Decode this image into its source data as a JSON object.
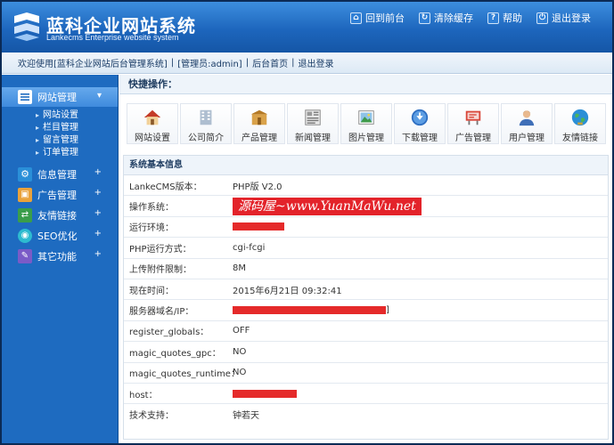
{
  "header": {
    "logo_cn": "蓝科企业网站系统",
    "logo_en": "Lankecms Enterprise website system",
    "links": [
      {
        "label": "回到前台",
        "icon": "home-icon"
      },
      {
        "label": "清除缓存",
        "icon": "refresh-icon"
      },
      {
        "label": "帮助",
        "icon": "help-icon"
      },
      {
        "label": "退出登录",
        "icon": "logout-icon"
      }
    ]
  },
  "infobar": {
    "welcome": "欢迎使用[蓝科企业网站后台管理系统]",
    "admin": "[管理员:admin]",
    "home": "后台首页",
    "logout": "退出登录"
  },
  "sidebar": {
    "active": {
      "label": "网站管理",
      "items": [
        "网站设置",
        "栏目管理",
        "留言管理",
        "订单管理"
      ]
    },
    "groups": [
      {
        "label": "信息管理",
        "icon": "gear-icon"
      },
      {
        "label": "广告管理",
        "icon": "ad-icon"
      },
      {
        "label": "友情链接",
        "icon": "link-icon"
      },
      {
        "label": "SEO优化",
        "icon": "seo-icon"
      },
      {
        "label": "其它功能",
        "icon": "tools-icon"
      }
    ]
  },
  "quick": {
    "title": "快捷操作：",
    "buttons": [
      {
        "label": "网站设置",
        "icon": "house-icon"
      },
      {
        "label": "公司简介",
        "icon": "building-icon"
      },
      {
        "label": "产品管理",
        "icon": "product-icon"
      },
      {
        "label": "新闻管理",
        "icon": "news-icon"
      },
      {
        "label": "图片管理",
        "icon": "picture-icon"
      },
      {
        "label": "下载管理",
        "icon": "download-icon"
      },
      {
        "label": "广告管理",
        "icon": "billboard-icon"
      },
      {
        "label": "用户管理",
        "icon": "user-icon"
      },
      {
        "label": "友情链接",
        "icon": "globe-icon"
      }
    ]
  },
  "sysinfo": {
    "title": "系统基本信息",
    "rows": [
      {
        "key": "LankeCMS版本：",
        "value": "PHP版 V2.0"
      },
      {
        "key": "操作系统：",
        "value": ""
      },
      {
        "key": "运行环境：",
        "value": ""
      },
      {
        "key": "PHP运行方式：",
        "value": "cgi-fcgi"
      },
      {
        "key": "上传附件限制：",
        "value": "8M"
      },
      {
        "key": "现在时间：",
        "value": "2015年6月21日 09:32:41"
      },
      {
        "key": "服务器域名/IP：",
        "value": "]"
      },
      {
        "key": "register_globals：",
        "value": "OFF"
      },
      {
        "key": "magic_quotes_gpc：",
        "value": "NO"
      },
      {
        "key": "magic_quotes_runtime：",
        "value": "NO"
      },
      {
        "key": "host：",
        "value": ""
      },
      {
        "key": "技术支持：",
        "value": "钟若天"
      }
    ],
    "watermark": "源码屋~www.YuanMaWu.net"
  },
  "colors": {
    "header": "#1d66bd",
    "sidebar": "#1e6bc0",
    "redact": "#e52a2a"
  }
}
